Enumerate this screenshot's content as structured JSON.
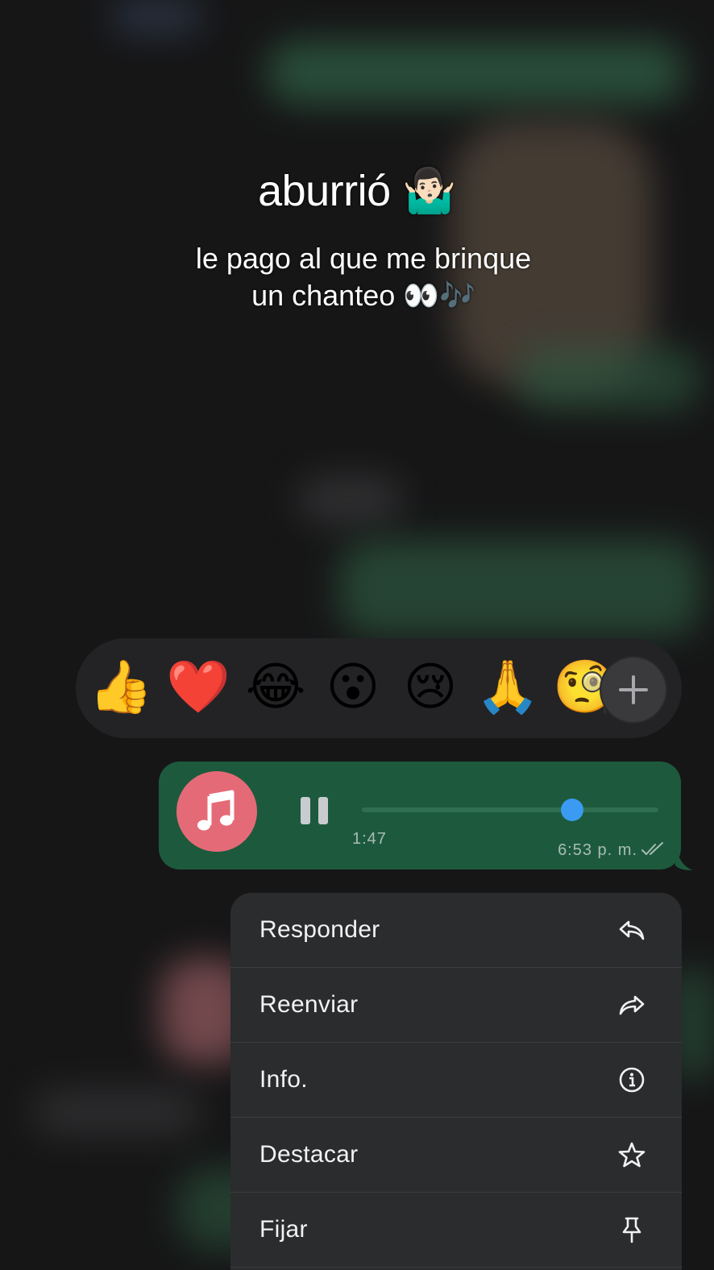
{
  "caption": {
    "title": "aburrió 🤷🏻‍♂️",
    "subtitle_line1": "le pago al que me brinque",
    "subtitle_line2": "un chanteo 👀🎶"
  },
  "reactions": {
    "emojis": [
      "👍",
      "❤️",
      "😂",
      "😮",
      "😢",
      "🙏",
      "🧐"
    ],
    "add_icon": "plus-icon"
  },
  "voice_message": {
    "avatar_icon": "music-note-icon",
    "state_icon": "pause-icon",
    "progress": 0.71,
    "duration": "1:47",
    "time": "6:53 p. m.",
    "status_icon": "double-check-icon",
    "bubble_color": "#1d5a3d",
    "avatar_color": "#e56a77",
    "knob_color": "#3b9bf3"
  },
  "menu": {
    "items": [
      {
        "label": "Responder",
        "icon": "reply-icon"
      },
      {
        "label": "Reenviar",
        "icon": "forward-icon"
      },
      {
        "label": "Info.",
        "icon": "info-icon"
      },
      {
        "label": "Destacar",
        "icon": "star-icon"
      },
      {
        "label": "Fijar",
        "icon": "pin-icon"
      }
    ]
  }
}
